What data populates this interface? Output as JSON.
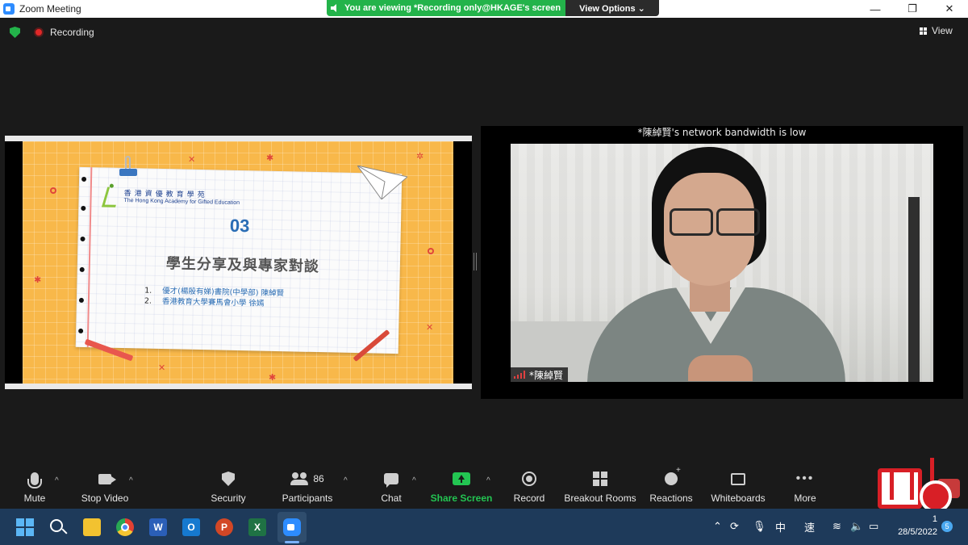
{
  "window": {
    "title": "Zoom Meeting",
    "minimize_icon": "minimize-icon",
    "maximize_icon": "restore-icon",
    "close_icon": "close-icon"
  },
  "banner": {
    "viewing_text": "You are viewing *Recording only@HKAGE's screen",
    "view_options_label": "View Options ⌄"
  },
  "status": {
    "recording_label": "Recording",
    "view_label": "View"
  },
  "slide": {
    "logo_zh": "香港資優教育學苑",
    "logo_en": "The Hong Kong Academy for Gifted Education",
    "section_number": "03",
    "title": "學生分享及與專家對談",
    "items": [
      {
        "num": "1.",
        "text": "優才(楊殷有娣)書院(中學部) 陳綽賢"
      },
      {
        "num": "2.",
        "text": "香港教育大學賽馬會小學 徐嫣"
      }
    ]
  },
  "video": {
    "bandwidth_notice": "*陳綽賢's network bandwidth is low",
    "participant_name": "*陳綽賢"
  },
  "toolbar": {
    "mute": "Mute",
    "stop_video": "Stop Video",
    "security": "Security",
    "participants": "Participants",
    "participants_count": "86",
    "chat": "Chat",
    "share_screen": "Share Screen",
    "record": "Record",
    "breakout_rooms": "Breakout Rooms",
    "reactions": "Reactions",
    "whiteboards": "Whiteboards",
    "more": "More"
  },
  "taskbar": {
    "ime_label": "中",
    "speed_label": "速",
    "time": "1",
    "date": "28/5/2022",
    "notification_count": "5",
    "apps": [
      "windows-start",
      "search",
      "file-explorer",
      "chrome",
      "word",
      "outlook",
      "powerpoint",
      "excel",
      "zoom"
    ]
  },
  "colors": {
    "accent_green": "#23b34a",
    "zoom_blue": "#2d8cff",
    "record_red": "#e02828",
    "taskbar_blue": "#1e3a5a"
  }
}
